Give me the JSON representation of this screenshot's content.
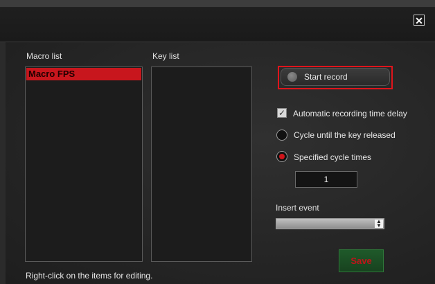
{
  "window": {
    "close_glyph": "✕"
  },
  "macro_list": {
    "label": "Macro list",
    "items": [
      "Macro FPS"
    ],
    "selected_color": "#c8161d"
  },
  "key_list": {
    "label": "Key list"
  },
  "record": {
    "label": "Start record",
    "highlight_color": "#e0141b"
  },
  "options": {
    "auto_delay": {
      "label": "Automatic recording time delay",
      "checked": true
    },
    "cycle_until_release": {
      "label": "Cycle until the key released",
      "selected": false
    },
    "specified_cycles": {
      "label": "Specified cycle times",
      "selected": true
    },
    "cycle_count": "1"
  },
  "insert_event": {
    "label": "Insert event",
    "value": ""
  },
  "save": {
    "label": "Save"
  },
  "hint": "Right-click on the items for editing."
}
